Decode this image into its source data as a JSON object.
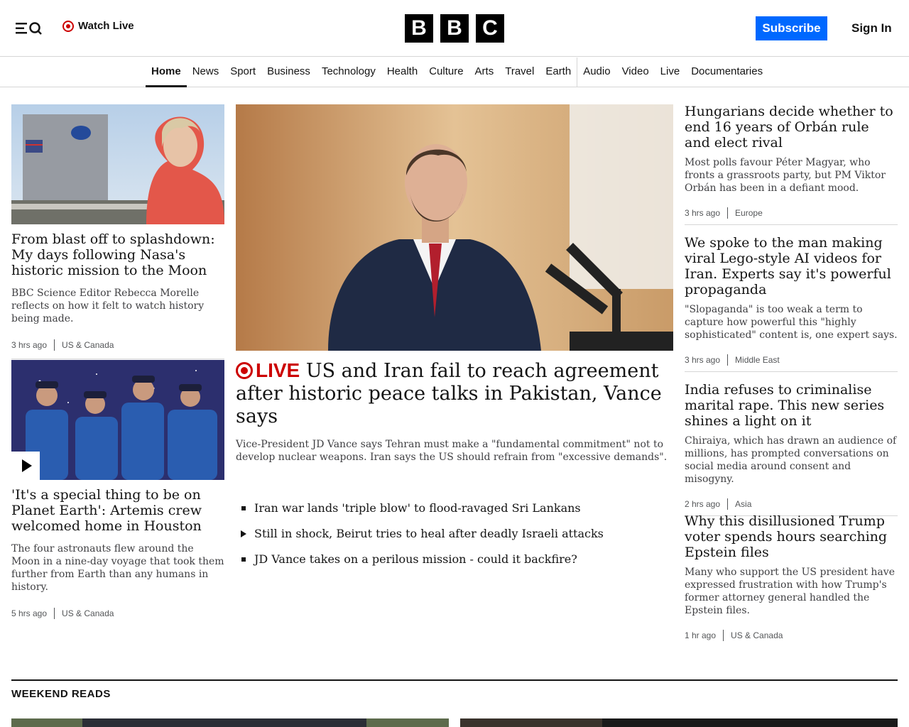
{
  "header": {
    "watch_live": "Watch Live",
    "logo_letters": [
      "B",
      "B",
      "C"
    ],
    "subscribe": "Subscribe",
    "sign_in": "Sign In"
  },
  "nav": {
    "items": [
      "Home",
      "News",
      "Sport",
      "Business",
      "Technology",
      "Health",
      "Culture",
      "Arts",
      "Travel",
      "Earth",
      "Audio",
      "Video",
      "Live",
      "Documentaries"
    ],
    "active": "Home"
  },
  "left_stories": [
    {
      "headline": "From blast off to splashdown: My days following Nasa's historic mission to the Moon",
      "summary": "BBC Science Editor Rebecca Morelle reflects on how it felt to watch history being made.",
      "time": "3 hrs ago",
      "section": "US & Canada"
    },
    {
      "headline": "'It's a special thing to be on Planet Earth': Artemis crew welcomed home in Houston",
      "summary": "The four astronauts flew around the Moon in a nine-day voyage that took them further from Earth than any humans in history.",
      "time": "5 hrs ago",
      "section": "US & Canada"
    }
  ],
  "main_story": {
    "live_label": "LIVE",
    "headline": "US and Iran fail to reach agreement after historic peace talks in Pakistan, Vance says",
    "summary": "Vice-President JD Vance says Tehran must make a \"fundamental commitment\" not to develop nuclear weapons. Iran says the US should refrain from \"excessive demands\".",
    "related": [
      "Iran war lands 'triple blow' to flood-ravaged Sri Lankans",
      "Still in shock, Beirut tries to heal after deadly Israeli attacks",
      "JD Vance takes on a perilous mission - could it backfire?"
    ]
  },
  "right_stories": [
    {
      "headline": "Hungarians decide whether to end 16 years of Orbán rule and elect rival",
      "summary": "Most polls favour Péter Magyar, who fronts a grassroots party, but PM Viktor Orbán has been in a defiant mood.",
      "time": "3 hrs ago",
      "section": "Europe"
    },
    {
      "headline": "We spoke to the man making viral Lego-style AI videos for Iran. Experts say it's powerful propaganda",
      "summary": "\"Slopaganda\" is too weak a term to capture how powerful this \"highly sophisticated\" content is, one expert says.",
      "time": "3 hrs ago",
      "section": "Middle East"
    },
    {
      "headline": "India refuses to criminalise marital rape. This new series shines a light on it",
      "summary": "Chiraiya, which has drawn an audience of millions, has prompted conversations on social media around consent and misogyny.",
      "time": "2 hrs ago",
      "section": "Asia"
    },
    {
      "headline": "Why this disillusioned Trump voter spends hours searching Epstein files",
      "summary": "Many who support the US president have expressed frustration with how Trump's former attorney general handled the Epstein files.",
      "time": "1 hr ago",
      "section": "US & Canada"
    }
  ],
  "sections": {
    "weekend_reads": "WEEKEND READS"
  },
  "colors": {
    "live_red": "#cc0000",
    "subscribe_blue": "#0068ff"
  }
}
